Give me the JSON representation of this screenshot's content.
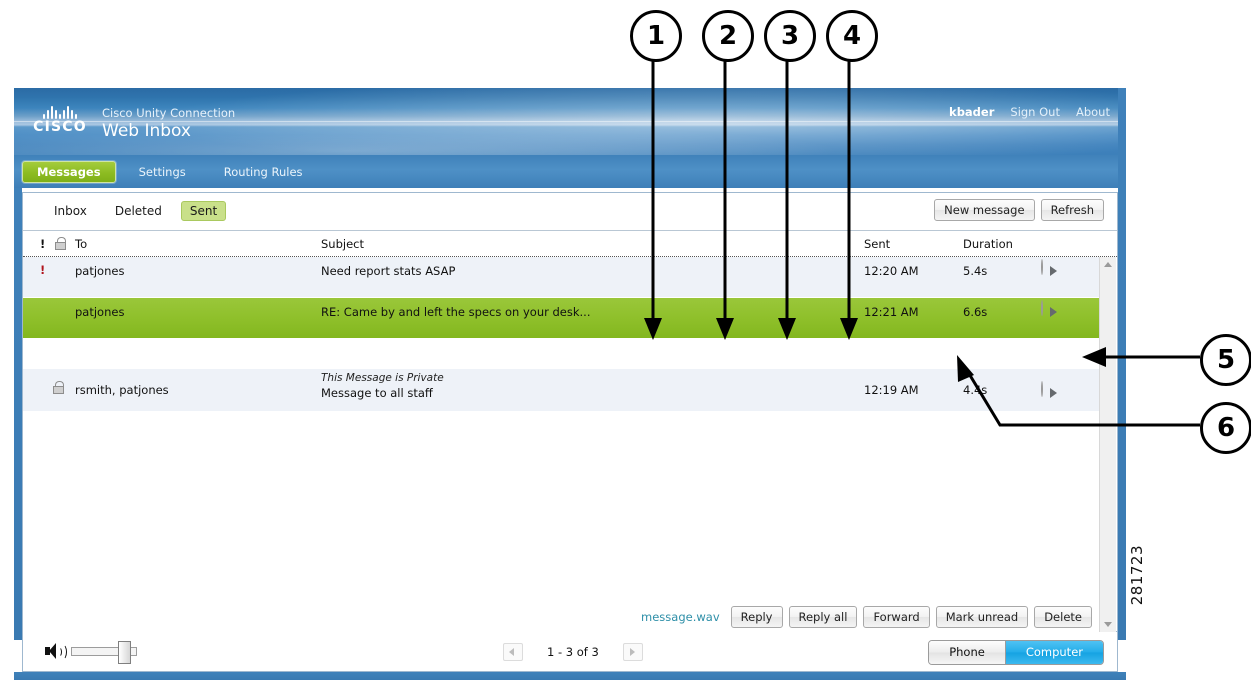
{
  "banner": {
    "logo_wordmark": "CISCO",
    "product_name": "Cisco Unity Connection",
    "app_title": "Web Inbox",
    "user": "kbader",
    "sign_out": "Sign Out",
    "about": "About"
  },
  "tabs": [
    {
      "label": "Messages",
      "active": true
    },
    {
      "label": "Settings",
      "active": false
    },
    {
      "label": "Routing Rules",
      "active": false
    }
  ],
  "folders": [
    {
      "label": "Inbox",
      "selected": false
    },
    {
      "label": "Deleted",
      "selected": false
    },
    {
      "label": "Sent",
      "selected": true
    }
  ],
  "toolbar": {
    "new_message": "New message",
    "refresh": "Refresh"
  },
  "columns": {
    "urgent": "!",
    "secure": "lock-icon",
    "to": "To",
    "subject": "Subject",
    "sent": "Sent",
    "duration": "Duration"
  },
  "messages": [
    {
      "urgent": "!",
      "secure": false,
      "to": "patjones",
      "subject": "Need report stats ASAP",
      "private_label": "",
      "sent": "12:20 AM",
      "duration": "5.4s",
      "selected": false
    },
    {
      "urgent": "",
      "secure": false,
      "to": "patjones",
      "subject": "RE: Came by and left the specs on your desk...",
      "private_label": "",
      "sent": "12:21 AM",
      "duration": "6.6s",
      "selected": true
    },
    {
      "urgent": "",
      "secure": true,
      "to": "rsmith, patjones",
      "subject": "Message to all staff",
      "private_label": "This Message is Private",
      "sent": "12:19 AM",
      "duration": "4.4s",
      "selected": false
    }
  ],
  "actions": {
    "attachment": "message.wav",
    "reply": "Reply",
    "reply_all": "Reply all",
    "forward": "Forward",
    "mark_unread": "Mark unread",
    "delete": "Delete"
  },
  "status_bar": {
    "pager_text": "1 - 3 of 3",
    "playback_phone": "Phone",
    "playback_computer": "Computer"
  },
  "callouts": [
    {
      "number": "1",
      "target": "message.wav"
    },
    {
      "number": "2",
      "target": "Reply"
    },
    {
      "number": "3",
      "target": "Reply all"
    },
    {
      "number": "4",
      "target": "Forward"
    },
    {
      "number": "5",
      "target": "Delete"
    },
    {
      "number": "6",
      "target": "Mark unread"
    }
  ],
  "figure_number": "281723",
  "colors": {
    "banner_blue": "#3d80ba",
    "accent_green": "#8fc02b",
    "folder_selected": "#c9e08a",
    "link_teal": "#2e8fa8",
    "toggle_on": "#22ace9"
  }
}
